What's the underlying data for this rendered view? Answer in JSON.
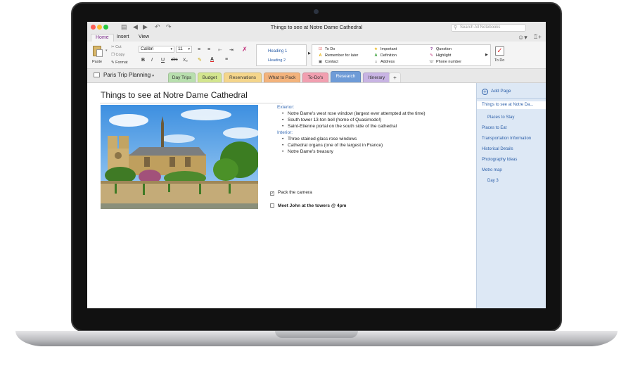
{
  "window": {
    "title": "Things to see at Notre Dame Cathedral",
    "search_placeholder": "Search All Notebooks"
  },
  "ribbon_tabs": [
    "Home",
    "Insert",
    "View"
  ],
  "ribbon": {
    "clipboard": {
      "paste": "Paste",
      "cut": "Cut",
      "copy": "Copy",
      "format": "Format"
    },
    "font_name": "Calibri",
    "font_size": "11",
    "format_buttons": [
      "B",
      "I",
      "U",
      "abc",
      "X₂"
    ],
    "styles": [
      "Heading 1",
      "Heading 2"
    ],
    "tags": {
      "col1": [
        "To Do",
        "Remember for later",
        "Contact"
      ],
      "col2": [
        "Important",
        "Definition",
        "Address"
      ],
      "col3": [
        "Question",
        "Highlight",
        "Phone number"
      ]
    },
    "todo_tag_label": "To Do"
  },
  "notebook": {
    "name": "Paris Trip Planning",
    "sections": [
      {
        "label": "Day Trips",
        "color": "#b8dfae"
      },
      {
        "label": "Budget",
        "color": "#d3e58f"
      },
      {
        "label": "Reservations",
        "color": "#f4d58b"
      },
      {
        "label": "What to Pack",
        "color": "#f3b37c"
      },
      {
        "label": "To-Do's",
        "color": "#f19fb0"
      },
      {
        "label": "Research",
        "color": "#6e9bd7"
      },
      {
        "label": "Itinerary",
        "color": "#c8b4e3"
      },
      {
        "label": "+",
        "color": "#f4f4f4"
      }
    ],
    "active_section": "Research"
  },
  "page": {
    "title": "Things to see at Notre Dame Cathedral",
    "exterior_heading": "Exterior:",
    "exterior_items": [
      "Notre Dame's west rose window (largest ever attempted at the time)",
      "South tower 13-ton bell (home of Quasimodo!)",
      "Saint-Etienne portal on the south side of the cathedral"
    ],
    "interior_heading": "Interior:",
    "interior_items": [
      "Three stained-glass rose windows",
      "Cathedral organs (one of the largest in France)",
      "Notre Dame's treasury"
    ],
    "checklist": [
      {
        "label": "Pack the camera",
        "checked": true,
        "bold": false
      },
      {
        "label": "Meet John at the towers @ 4pm",
        "checked": false,
        "bold": true
      }
    ]
  },
  "pages_panel": {
    "add_label": "Add Page",
    "items": [
      {
        "label": "Things to see at Notre Da...",
        "sub": false,
        "selected": true
      },
      {
        "label": "Places to Stay",
        "sub": true,
        "selected": false
      },
      {
        "label": "Places to Eat",
        "sub": false,
        "selected": false
      },
      {
        "label": "Transportation Information",
        "sub": false,
        "selected": false
      },
      {
        "label": "Historical Details",
        "sub": false,
        "selected": false
      },
      {
        "label": "Photography Ideas",
        "sub": false,
        "selected": false
      },
      {
        "label": "Metro map",
        "sub": false,
        "selected": false
      },
      {
        "label": "Day 3",
        "sub": true,
        "selected": false
      }
    ]
  }
}
